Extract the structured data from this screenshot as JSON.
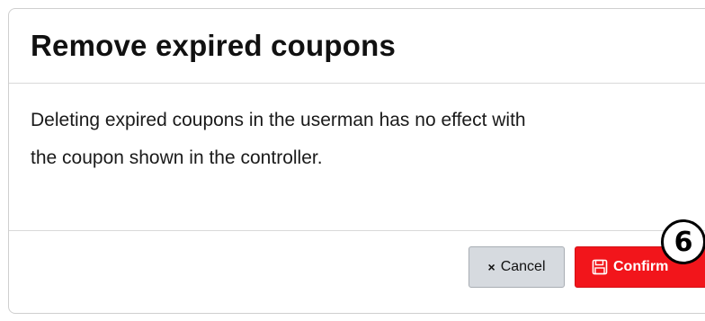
{
  "dialog": {
    "title": "Remove expired coupons",
    "message_line1": "Deleting expired coupons in the userman has no effect with",
    "message_line2": "the coupon shown in the controller.",
    "cancel_label": "Cancel",
    "cancel_icon": "x-icon",
    "confirm_label": "Confirm",
    "confirm_icon": "save-icon"
  },
  "annotation": {
    "step_number": "6"
  },
  "colors": {
    "confirm_background": "#f2151b",
    "cancel_background": "#d6dadf"
  }
}
